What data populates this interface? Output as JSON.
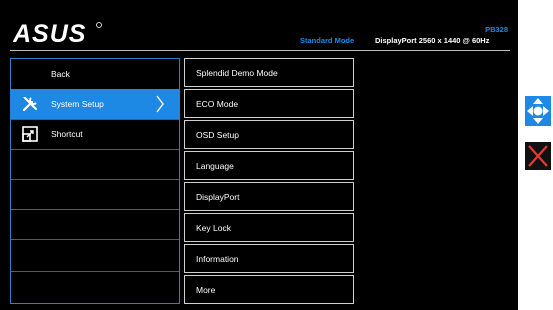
{
  "header": {
    "logo": "ASUS",
    "mode": "Standard Mode",
    "model": "PB328",
    "signal": "DisplayPort 2560 x 1440 @ 60Hz"
  },
  "main_menu": {
    "items": [
      {
        "label": "Back",
        "icon": "none"
      },
      {
        "label": "System Setup",
        "icon": "wrench-screwdriver-icon"
      },
      {
        "label": "Shortcut",
        "icon": "shortcut-icon"
      },
      {
        "label": ""
      },
      {
        "label": ""
      },
      {
        "label": ""
      },
      {
        "label": ""
      },
      {
        "label": ""
      }
    ]
  },
  "sub_menu": {
    "items": [
      "Splendid Demo Mode",
      "ECO Mode",
      "OSD Setup",
      "Language",
      "DisplayPort",
      "Key Lock",
      "Information",
      "More"
    ]
  },
  "buttons": {
    "navigate": "navigate-5way-icon",
    "close": "close-icon"
  },
  "colors": {
    "accent": "#1e88e5",
    "background": "#000000",
    "close": "#e53935"
  }
}
